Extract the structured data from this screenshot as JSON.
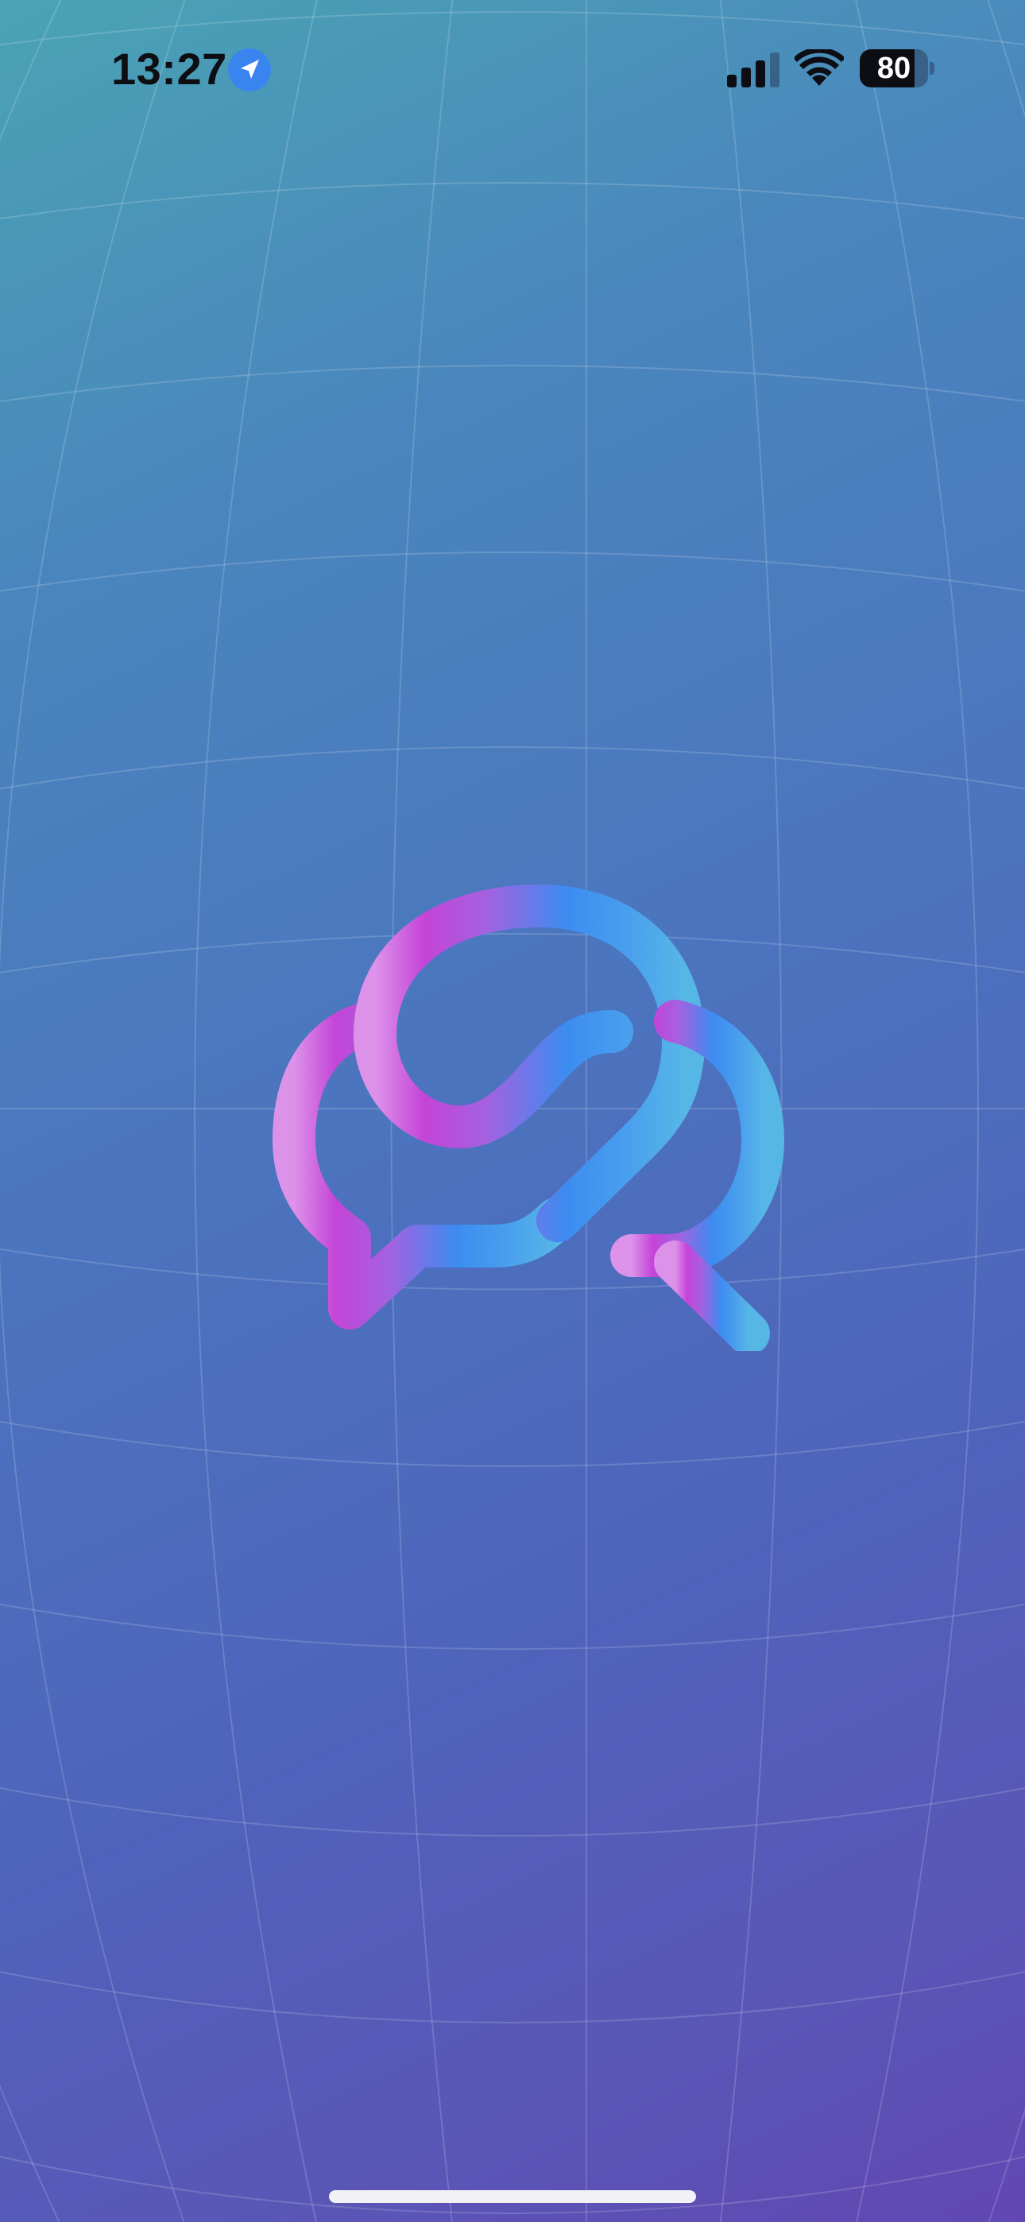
{
  "status_bar": {
    "time": "13:27",
    "battery_percent": 80,
    "battery_label": "80",
    "signal_bars": 3,
    "icons": [
      "location-arrow-icon",
      "cellular-signal-icon",
      "wifi-icon",
      "battery-icon"
    ]
  },
  "splash": {
    "logo_icon": "chat-bubbles-logo-icon",
    "colors": {
      "background_top": "#4aa3b4",
      "background_bottom": "#6147b2",
      "logo_pink": "#c444d8",
      "logo_blue": "#3c8cf0",
      "logo_cyan": "#56b6e6",
      "location_badge": "#3a84f0"
    }
  }
}
